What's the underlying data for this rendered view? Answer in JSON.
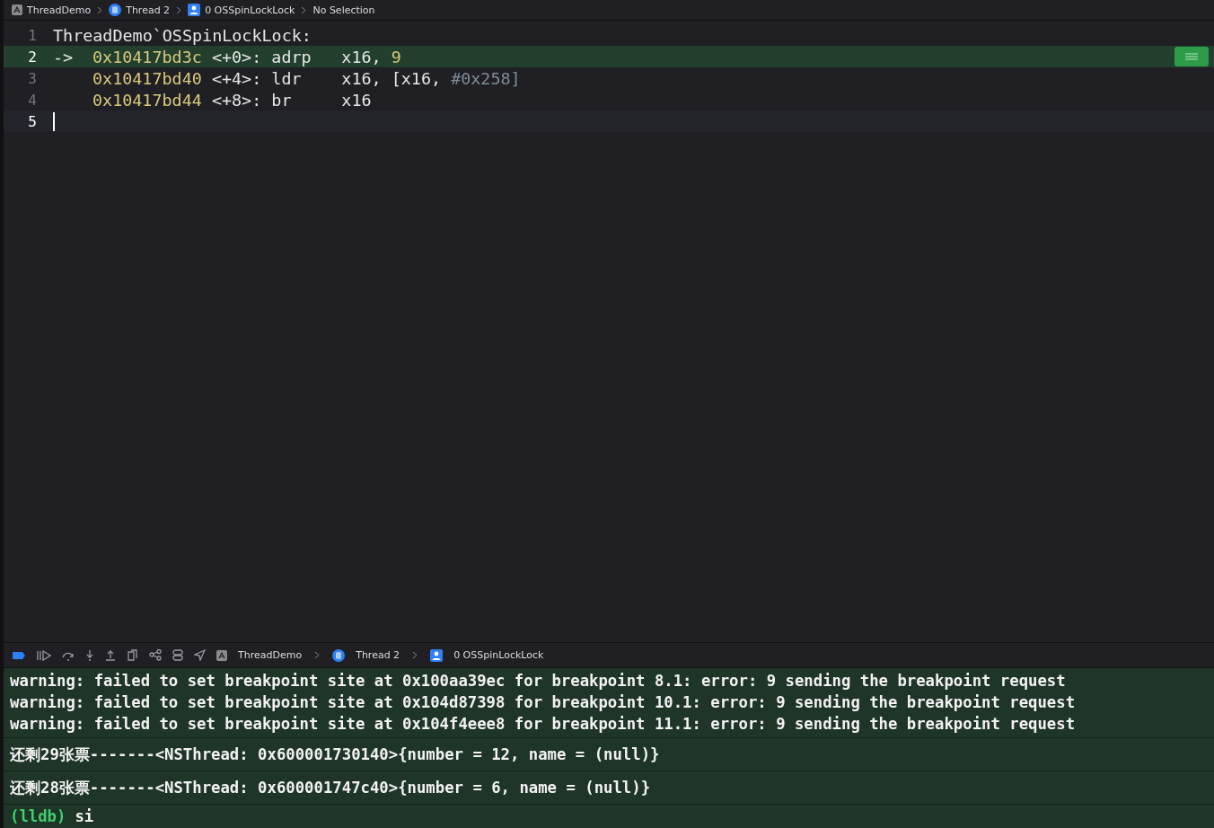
{
  "jump_bar": [
    {
      "kind": "app",
      "label": "ThreadDemo"
    },
    {
      "kind": "thread",
      "label": "Thread 2"
    },
    {
      "kind": "frame",
      "label": "0 OSSpinLockLock"
    },
    {
      "kind": "plain",
      "label": "No Selection"
    }
  ],
  "editor": {
    "lines": [
      {
        "number": "1",
        "current": false,
        "cursor": false,
        "tokens": [
          {
            "kind": "label",
            "text": "ThreadDemo`OSSpinLockLock:"
          }
        ]
      },
      {
        "number": "2",
        "current": true,
        "cursor": false,
        "tokens": [
          {
            "kind": "arrow",
            "text": "->"
          },
          {
            "kind": "address",
            "text": "0x10417bd3c"
          },
          {
            "kind": "plain",
            "text": "<+0>:"
          },
          {
            "kind": "mnemonic",
            "text": "adrp"
          },
          {
            "kind": "plain",
            "text": "x16,"
          },
          {
            "kind": "number",
            "text": "9"
          }
        ]
      },
      {
        "number": "3",
        "current": false,
        "cursor": false,
        "tokens": [
          {
            "kind": "address",
            "text": "0x10417bd40"
          },
          {
            "kind": "plain",
            "text": "<+4>:"
          },
          {
            "kind": "mnemonic",
            "text": "ldr"
          },
          {
            "kind": "plain",
            "text": "x16, [x16,"
          },
          {
            "kind": "comment",
            "text": "#0x258]"
          }
        ]
      },
      {
        "number": "4",
        "current": false,
        "cursor": false,
        "tokens": [
          {
            "kind": "address",
            "text": "0x10417bd44"
          },
          {
            "kind": "plain",
            "text": "<+8>:"
          },
          {
            "kind": "mnemonic",
            "text": "br"
          },
          {
            "kind": "plain",
            "text": "x16"
          }
        ]
      },
      {
        "number": "5",
        "current": false,
        "cursor": true
      }
    ]
  },
  "debug_bar": {
    "breakpoints_active": true,
    "path": [
      {
        "kind": "app",
        "label": "ThreadDemo"
      },
      {
        "kind": "thread",
        "label": "Thread 2"
      },
      {
        "kind": "frame",
        "label": "0 OSSpinLockLock"
      }
    ]
  },
  "console": {
    "blocks": [
      {
        "kind": "warnings",
        "lines": [
          "warning: failed to set breakpoint site at 0x100aa39ec for breakpoint 8.1: error: 9 sending the breakpoint request",
          "warning: failed to set breakpoint site at 0x104d87398 for breakpoint 10.1: error: 9 sending the breakpoint request",
          "warning: failed to set breakpoint site at 0x104f4eee8 for breakpoint 11.1: error: 9 sending the breakpoint request"
        ]
      },
      {
        "kind": "output",
        "lines": [
          "还剩29张票-------<NSThread: 0x600001730140>{number = 12, name = (null)}"
        ]
      },
      {
        "kind": "output",
        "lines": [
          "还剩28张票-------<NSThread: 0x600001747c40>{number = 6, name = (null)}"
        ]
      }
    ],
    "prompt": "(lldb)",
    "input": "si"
  }
}
